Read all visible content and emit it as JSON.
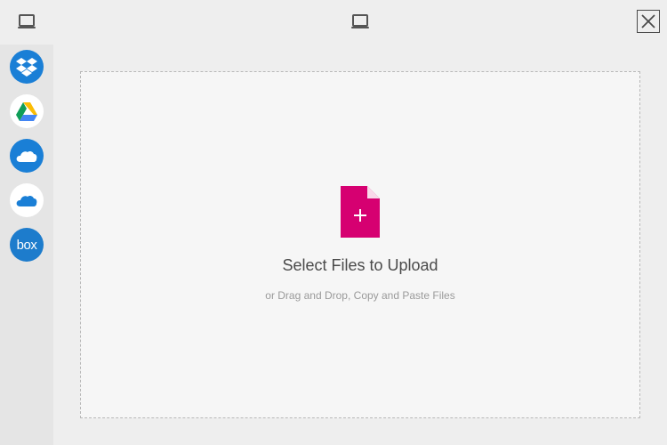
{
  "header": {
    "local_icon": "laptop-icon",
    "title_icon": "laptop-icon",
    "close_icon": "close-icon"
  },
  "sidebar": {
    "sources": [
      {
        "name": "Dropbox",
        "icon": "dropbox-icon"
      },
      {
        "name": "Google Drive",
        "icon": "google-drive-icon"
      },
      {
        "name": "OneDrive",
        "icon": "onedrive-icon"
      },
      {
        "name": "OneDrive for Business",
        "icon": "onedrive-business-icon"
      },
      {
        "name": "Box",
        "icon": "box-icon",
        "label": "box"
      }
    ]
  },
  "dropzone": {
    "title": "Select Files to Upload",
    "subtitle": "or Drag and Drop, Copy and Paste Files",
    "icon": "add-file-icon"
  },
  "colors": {
    "accent": "#d60071",
    "dropbox": "#1a7fd6",
    "onedrive": "#1a7fd6",
    "box": "#1d7ccc"
  }
}
